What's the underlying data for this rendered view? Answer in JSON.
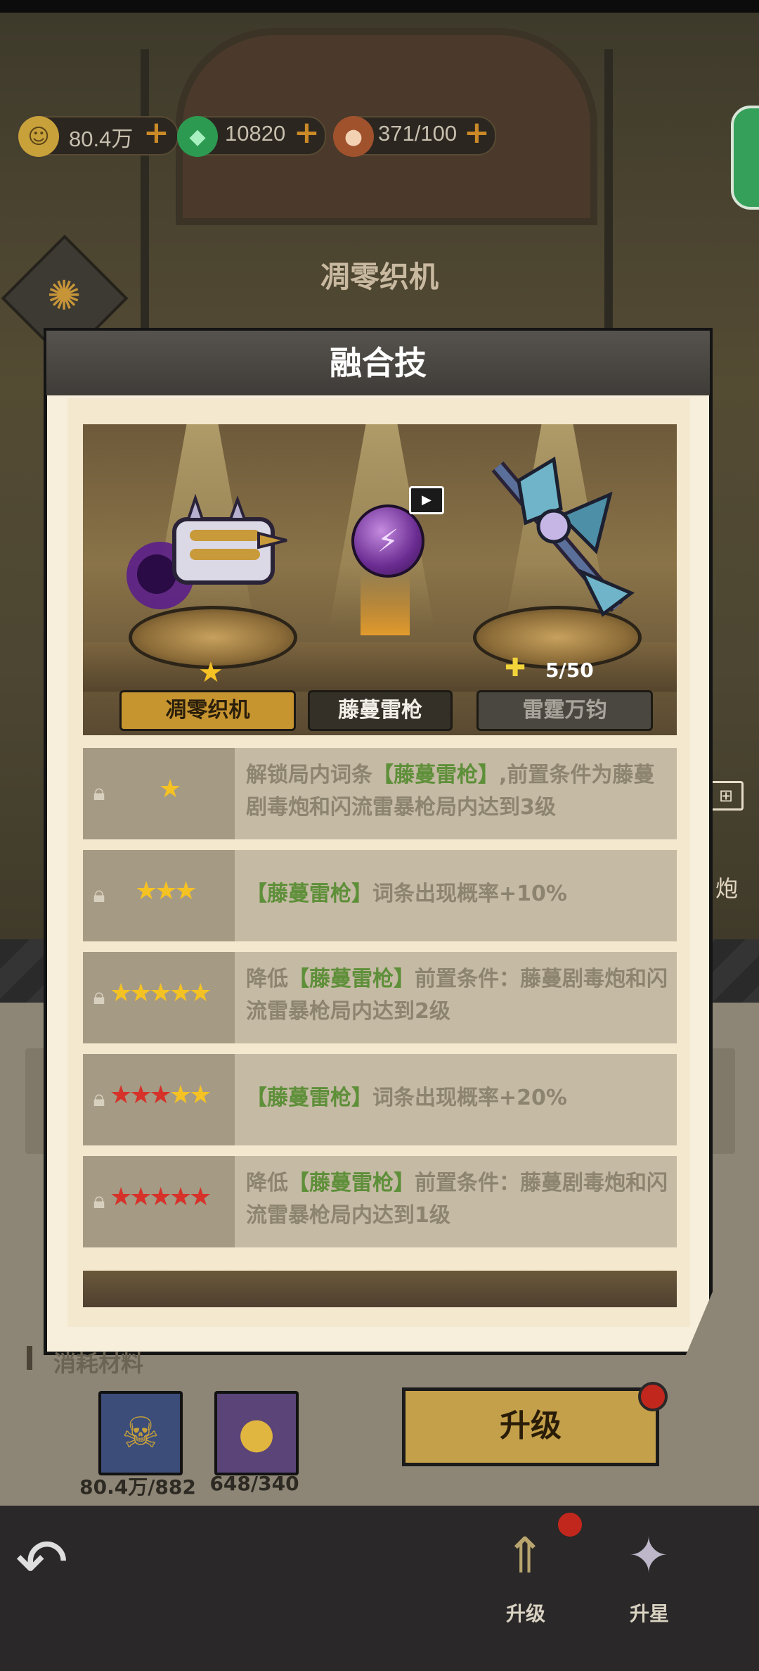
{
  "resources": [
    {
      "icon": "gold-coin-icon",
      "value": "80.4万"
    },
    {
      "icon": "gem-icon",
      "value": "10820"
    },
    {
      "icon": "stamina-meat-icon",
      "value": "371/100"
    }
  ],
  "background": {
    "title": "凋零织机",
    "side_label": "炮"
  },
  "dialog": {
    "title": "融合技",
    "showcase": {
      "left_weapon": "凋零织机",
      "center_skill": "藤蔓雷枪",
      "right_weapon": "雷霆万钧",
      "fragments": "5/50"
    },
    "rows": [
      {
        "stars": "★",
        "text_a": "解锁局内词条",
        "highlight": "【藤蔓雷枪】",
        "text_b": ",前置条件为藤蔓剧毒炮和闪流雷暴枪局内达到3级"
      },
      {
        "stars": "★★★",
        "text_a": "",
        "highlight": "【藤蔓雷枪】",
        "text_b": "词条出现概率+10%"
      },
      {
        "stars": "★★★★★",
        "text_a": "降低",
        "highlight": "【藤蔓雷枪】",
        "text_b": "前置条件：藤蔓剧毒炮和闪流雷暴枪局内达到2级"
      },
      {
        "stars": "★★★★★",
        "text_a": "",
        "highlight": "【藤蔓雷枪】",
        "text_b": "词条出现概率+20%"
      },
      {
        "stars": "★★★★★",
        "text_a": "降低",
        "highlight": "【藤蔓雷枪】",
        "text_b": "前置条件：藤蔓剧毒炮和闪流雷暴枪局内达到1级"
      }
    ]
  },
  "materials": {
    "label": "消耗材料",
    "items": [
      {
        "icon": "skull-coin-icon",
        "value": "80.4万/882"
      },
      {
        "icon": "orb-capsule-icon",
        "value": "648/340"
      }
    ],
    "upgrade_button": "升级"
  },
  "nav": {
    "upgrade": "升级",
    "star_up": "升星"
  },
  "colors": {
    "accent_gold": "#c4a04a",
    "highlight_green": "#5e8f39",
    "red_star": "#d6322a",
    "gold_star": "#f5c224"
  }
}
